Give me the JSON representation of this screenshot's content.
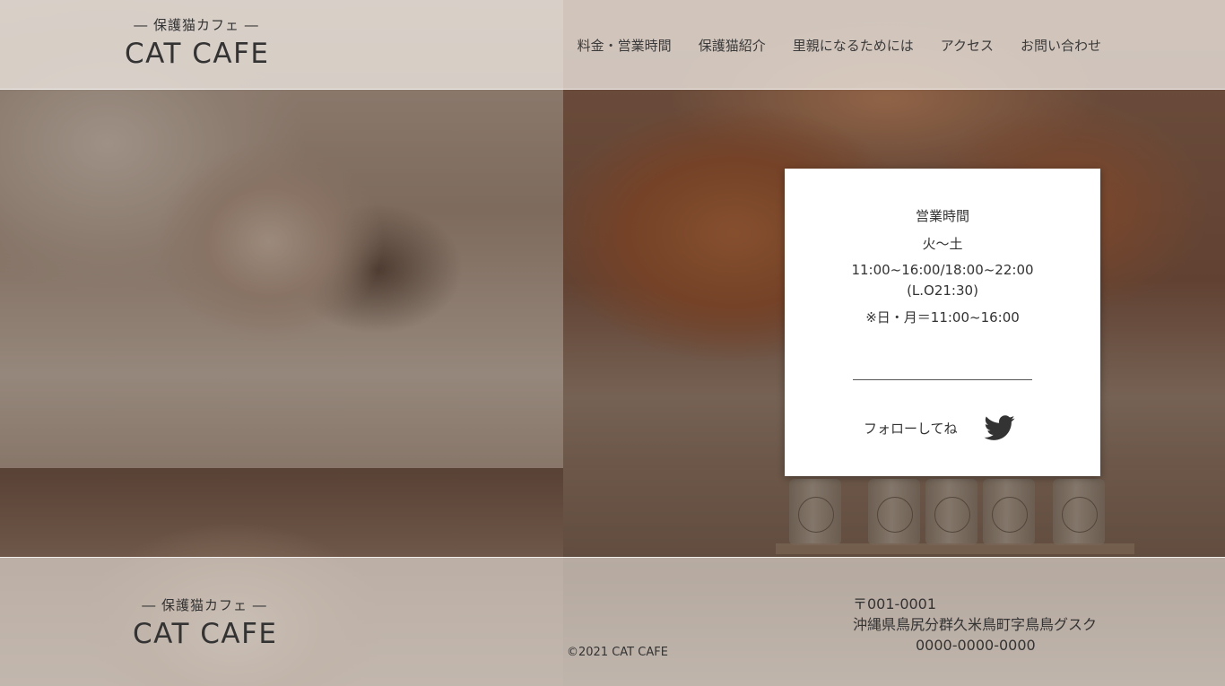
{
  "header": {
    "logo_sub": "― 保護猫カフェ ―",
    "logo_main": "CAT CAFE",
    "nav": [
      {
        "label": "料金・営業時間"
      },
      {
        "label": "保護猫紹介"
      },
      {
        "label": "里親になるためには"
      },
      {
        "label": "アクセス"
      },
      {
        "label": "お問い合わせ"
      }
    ]
  },
  "card": {
    "title": "営業時間",
    "days": "火〜土",
    "hours": "11:00~16:00/18:00~22:00",
    "last_order": "(L.O21:30)",
    "note": "※日・月＝11:00~16:00",
    "follow_label": "フォローしてね",
    "social_icon": "twitter-bird-icon"
  },
  "footer": {
    "logo_sub": "― 保護猫カフェ ―",
    "logo_main": "CAT CAFE",
    "copyright": "©2021 CAT CAFE",
    "postal": "〒001-0001",
    "address": "沖縄県鳥尻分群久米鳥町字鳥鳥グスク",
    "tel": "0000-0000-0000"
  },
  "colors": {
    "header_bg": "#ece5df",
    "text": "#333333",
    "card_bg": "#ffffff",
    "twitter": "#333333"
  }
}
